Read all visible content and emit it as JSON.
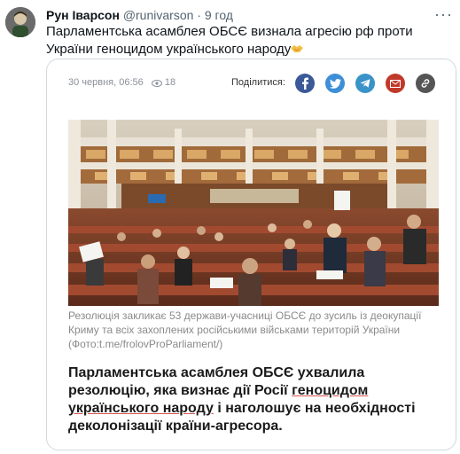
{
  "tweet": {
    "author": "Рун Іварсон",
    "handle": "@runivarson",
    "separator": "·",
    "time": "9 год",
    "more": "···",
    "text": "Парламентська асамблея ОБСЄ визнала агресію рф проти України геноцидом українського народу"
  },
  "card": {
    "date": "30 червня, 06:56",
    "views": "18",
    "share_label": "Поділитися:",
    "share_buttons": [
      {
        "name": "facebook",
        "color": "#3b5998"
      },
      {
        "name": "twitter",
        "color": "#3d8ed6"
      },
      {
        "name": "telegram",
        "color": "#3a93c8"
      },
      {
        "name": "email",
        "color": "#c0392b"
      },
      {
        "name": "copy-link",
        "color": "#555555"
      }
    ],
    "caption": "Резолюція закликає 53 держави-учасниці ОБСЄ до зусиль із деокупації Криму та всіх захоплених російськими військами територій України (Фото:t.me/frolovProParliament/)",
    "headline": {
      "part1": "Парламентська асамблея ОБСЄ ухвалила резолюцію, яка визнає дії Росії ",
      "part2": "геноцидом українського народу",
      "part3": " і наголошує на необхідності деколонізації країни-агресора."
    }
  }
}
